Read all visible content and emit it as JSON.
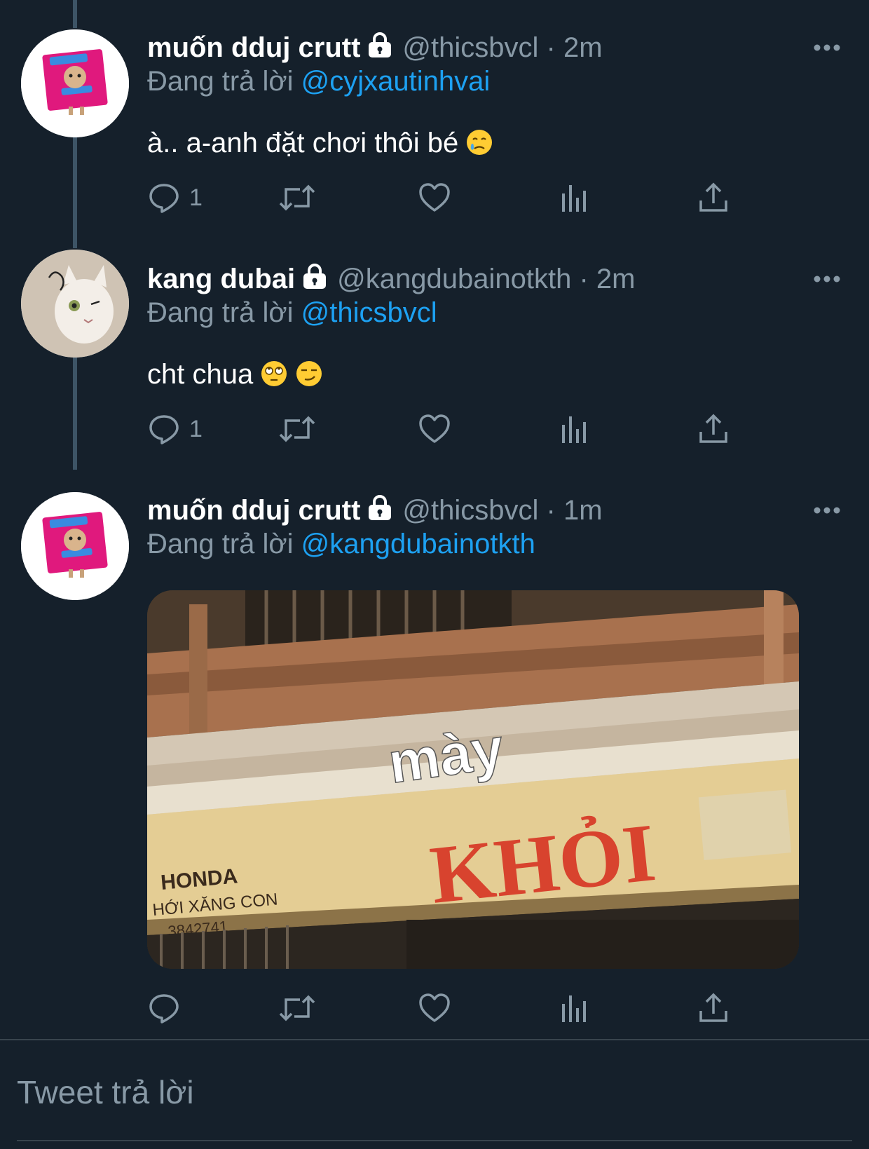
{
  "colors": {
    "background": "#15202b",
    "text": "#ffffff",
    "secondary": "#8899a6",
    "accent": "#1da1f2",
    "divider": "#38444d"
  },
  "tweets": [
    {
      "display_name": "muốn dduj crutt",
      "handle": "@thicsbvcl",
      "separator": "·",
      "time": "2m",
      "reply_prefix": "Đang trả lời",
      "reply_to": "@cyjxautinhvai",
      "text": "à.. a-anh đặt chơi thôi bé",
      "text_emoji": "face-holding-back-tears-emoji",
      "reply_count": "1",
      "avatar_icon": "durex-cat-avatar"
    },
    {
      "display_name": "kang dubai",
      "handle": "@kangdubainotkth",
      "separator": "·",
      "time": "2m",
      "reply_prefix": "Đang trả lời",
      "reply_to": "@thicsbvcl",
      "text": "cht chua",
      "text_emoji": "eye-roll-and-smirk-emoji",
      "reply_count": "1",
      "avatar_icon": "white-cat-avatar"
    },
    {
      "display_name": "muốn dduj crutt",
      "handle": "@thicsbvcl",
      "separator": "·",
      "time": "1m",
      "reply_prefix": "Đang trả lời",
      "reply_to": "@kangdubainotkth",
      "reply_count": "",
      "avatar_icon": "durex-cat-avatar",
      "media": {
        "caption": "mày",
        "sign_main": "KHỎI",
        "sign_left_line1": "HONDA",
        "sign_left_line2": "HỚI XĂNG CON",
        "sign_left_line3": "3842741"
      }
    }
  ],
  "reply_box": {
    "placeholder": "Tweet trả lời"
  }
}
